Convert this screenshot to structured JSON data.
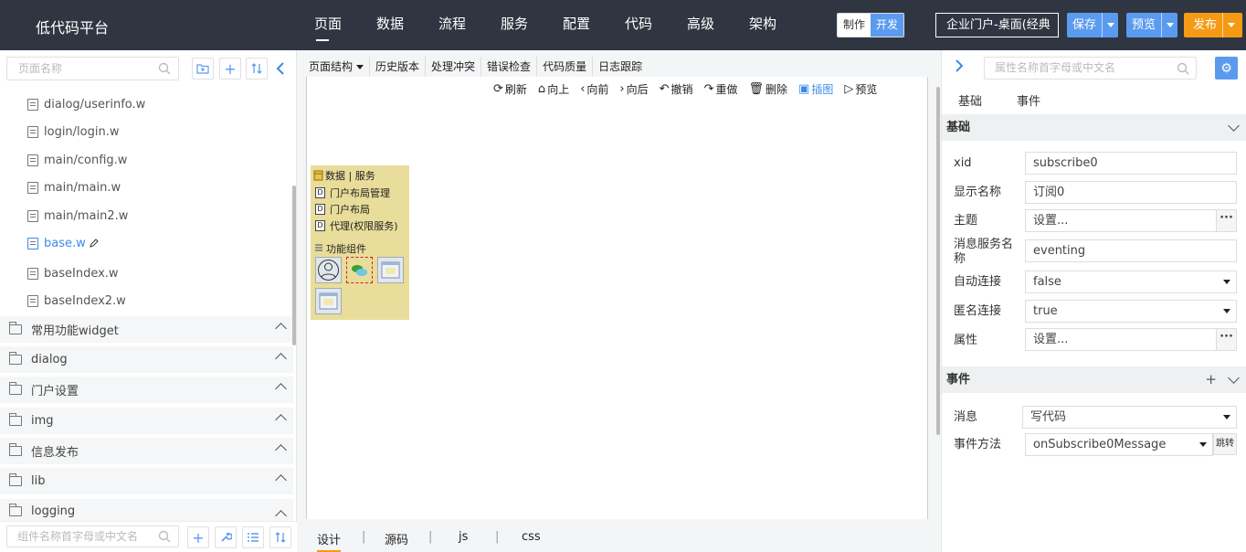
{
  "app": {
    "title": "低代码平台"
  },
  "nav": [
    {
      "label": "页面",
      "active": true
    },
    {
      "label": "数据"
    },
    {
      "label": "流程"
    },
    {
      "label": "服务"
    },
    {
      "label": "配置"
    },
    {
      "label": "代码"
    },
    {
      "label": "高级"
    },
    {
      "label": "架构"
    }
  ],
  "mode": {
    "make": "制作",
    "dev": "开发"
  },
  "project": {
    "value": "企业门户-桌面(经典"
  },
  "buttons": {
    "save": "保存",
    "preview": "预览",
    "publish": "发布"
  },
  "left": {
    "search_placeholder": "页面名称",
    "files": [
      {
        "name": "dialog/userinfo.w"
      },
      {
        "name": "login/login.w"
      },
      {
        "name": "main/config.w"
      },
      {
        "name": "main/main.w"
      },
      {
        "name": "main/main2.w"
      },
      {
        "name": "base.w",
        "current": true
      },
      {
        "name": "baseIndex.w"
      },
      {
        "name": "baseIndex2.w"
      }
    ],
    "folders": [
      {
        "name": "常用功能widget"
      },
      {
        "name": "dialog"
      },
      {
        "name": "门户设置"
      },
      {
        "name": "img"
      },
      {
        "name": "信息发布"
      },
      {
        "name": "lib"
      },
      {
        "name": "logging"
      }
    ],
    "component_search_placeholder": "组件名称首字母或中文名"
  },
  "center": {
    "toolbar": [
      "页面结构",
      "历史版本",
      "处理冲突",
      "错误检查",
      "代码质量",
      "日志跟踪"
    ],
    "actions": [
      {
        "label": "刷新",
        "icon": "refresh-icon"
      },
      {
        "label": "向上",
        "icon": "home-icon"
      },
      {
        "label": "向前",
        "icon": "back-icon"
      },
      {
        "label": "向后",
        "icon": "forward-icon"
      },
      {
        "label": "撤销",
        "icon": "undo-icon"
      },
      {
        "label": "重做",
        "icon": "redo-icon"
      },
      {
        "label": "删除",
        "icon": "trash-icon"
      },
      {
        "label": "插图",
        "icon": "image-icon"
      },
      {
        "label": "预览",
        "icon": "preview-icon"
      }
    ],
    "component_panel": {
      "header": "数据 | 服务",
      "items": [
        "门户布局管理",
        "门户布局",
        "代理(权限服务)"
      ],
      "functions_title": "功能组件"
    },
    "bottom_tabs": [
      "设计",
      "源码",
      "js",
      "css"
    ]
  },
  "right": {
    "search_placeholder": "属性名称首字母或中文名",
    "tabs": [
      "基础",
      "事件"
    ],
    "basic_title": "基础",
    "props": [
      {
        "label": "xid",
        "value": "subscribe0"
      },
      {
        "label": "显示名称",
        "value": "订阅0"
      },
      {
        "label": "主题",
        "value": "设置..."
      },
      {
        "label": "消息服务名称",
        "value": "eventing"
      },
      {
        "label": "自动连接",
        "value": "false"
      },
      {
        "label": "匿名连接",
        "value": "true"
      },
      {
        "label": "属性",
        "value": "设置..."
      }
    ],
    "events_title": "事件",
    "events": [
      {
        "label": "消息",
        "value": "写代码"
      },
      {
        "label": "事件方法",
        "value": "onSubscribe0Message"
      }
    ],
    "jump_label": "跳转"
  }
}
